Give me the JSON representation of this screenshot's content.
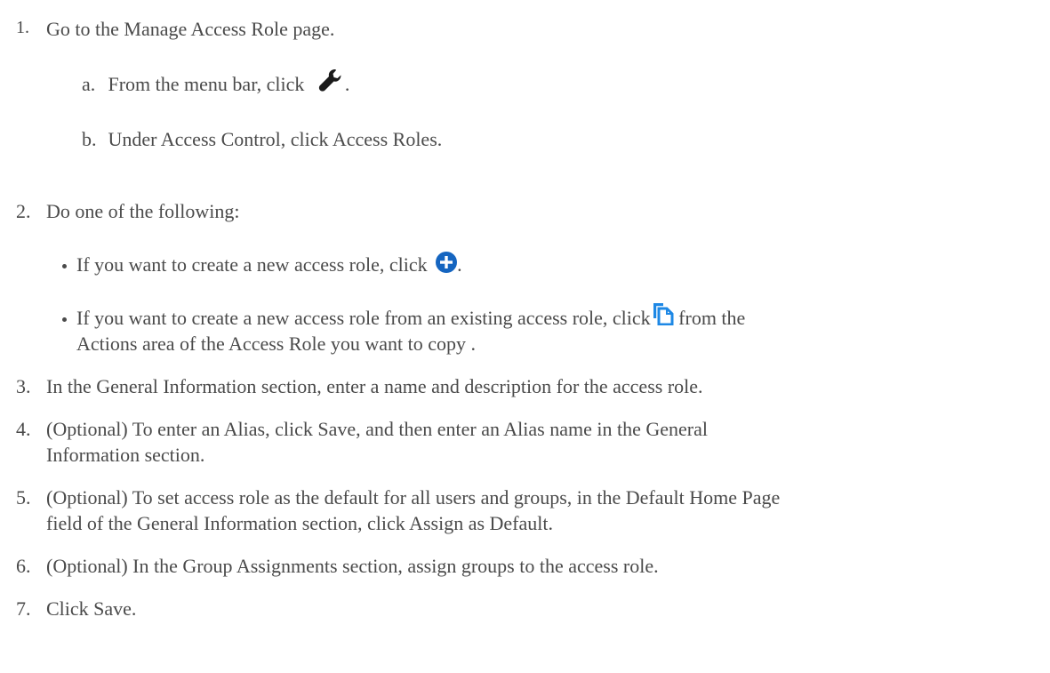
{
  "steps": [
    {
      "num": "1.",
      "text": "Go to the Manage Access Role page."
    },
    {
      "num": "2.",
      "text": "Do one of the following:"
    },
    {
      "num": "3.",
      "text": "In the General Information section, enter a name and description for the access role."
    },
    {
      "num": "4.",
      "text_line1": "(Optional) To enter an Alias, click Save, and then enter an Alias name in the General",
      "text_line2": "Information section."
    },
    {
      "num": "5.",
      "text_line1": "(Optional) To set access role as the default for all users and groups, in the Default Home Page",
      "text_line2": "field of the General Information section, click Assign as Default."
    },
    {
      "num": "6.",
      "text": "(Optional) In the Group Assignments section, assign groups to the access role."
    },
    {
      "num": "7.",
      "text": "Click Save."
    }
  ],
  "substeps": [
    {
      "letter": "a.",
      "text": "From the menu bar, click",
      "after": "."
    },
    {
      "letter": "b.",
      "text": "Under Access Control, click Access Roles."
    }
  ],
  "bullets": [
    {
      "text": "If you want to create a new access role, click",
      "after": "."
    },
    {
      "text_line1": "If you want to create a new access role from an existing access role, click",
      "text_after_icon": "from the",
      "text_line2": "Actions area of the Access Role you want to copy ."
    }
  ],
  "icons": {
    "wrench": "wrench-icon",
    "plus": "plus-circle-icon",
    "copy": "copy-icon"
  },
  "colors": {
    "text": "#4a4a4a",
    "plus_icon": "#1565c0",
    "copy_icon": "#1e88e5"
  }
}
